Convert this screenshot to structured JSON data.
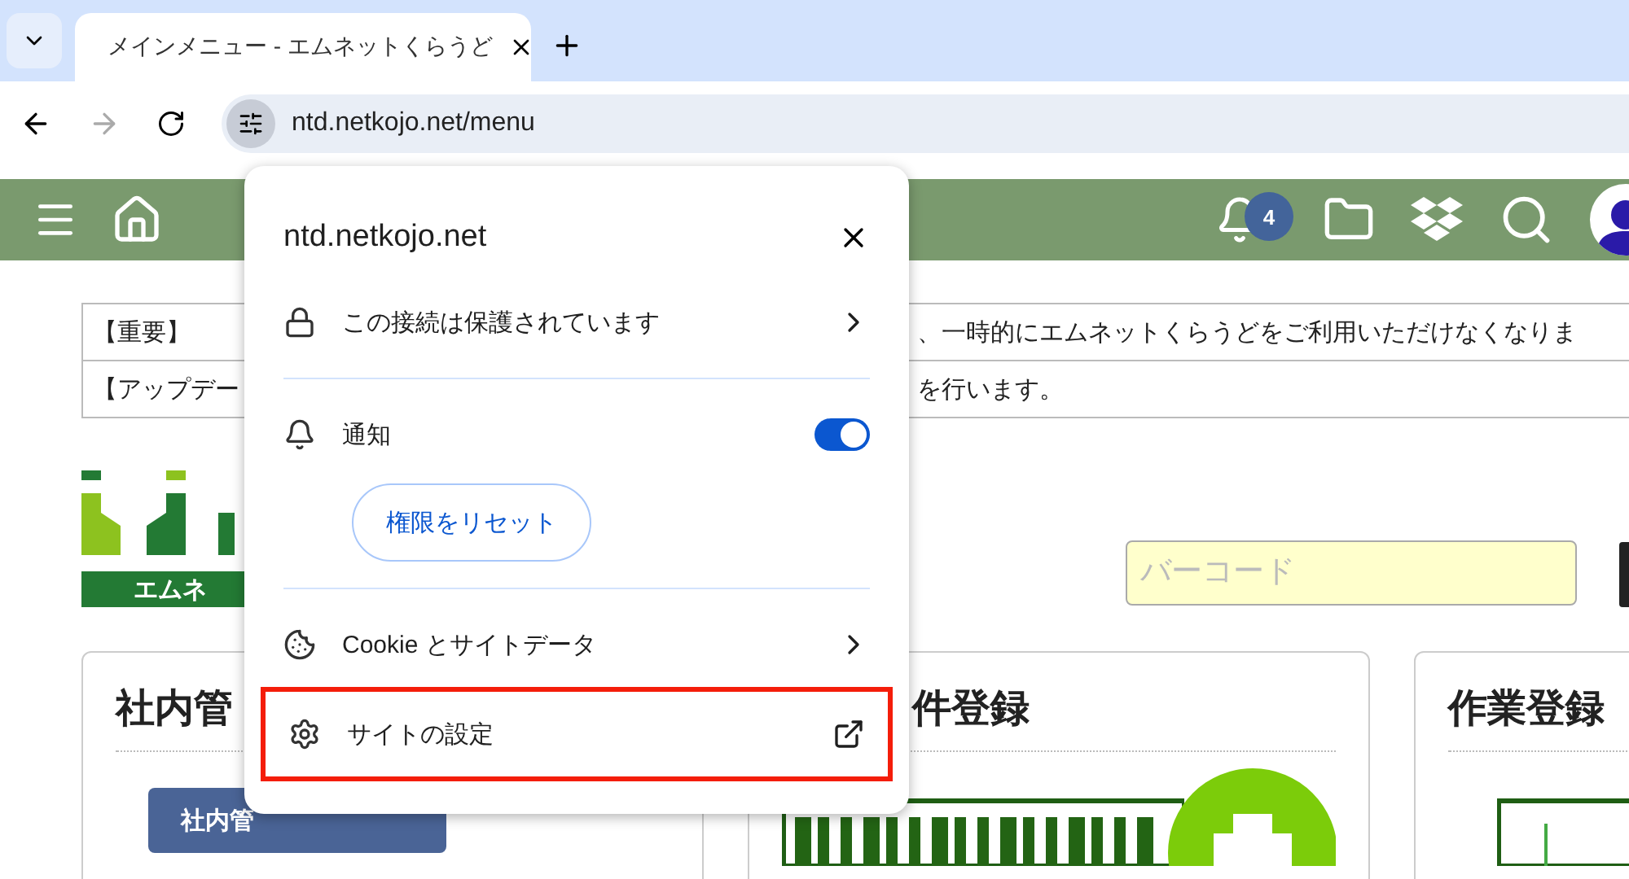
{
  "browser": {
    "tabs": [
      {
        "title": "メインメニュー - エムネットくらうど",
        "selected": true
      }
    ],
    "url": "ntd.netkojo.net/menu"
  },
  "header": {
    "notification_count": "4"
  },
  "notices": [
    {
      "label": "【重要】",
      "text": "、一時的にエムネットくらうどをご利用いただけなくなりま"
    },
    {
      "label": "【アップデー",
      "text": "を行います。"
    }
  ],
  "logo": {
    "caption": "エムネ"
  },
  "barcode": {
    "placeholder": "バーコード"
  },
  "cards": [
    {
      "kind": "button",
      "title": "社内管",
      "button": "社内管"
    },
    {
      "kind": "barcode",
      "title": "件登録"
    },
    {
      "kind": "diagram",
      "title": "作業登録"
    }
  ],
  "site_popup": {
    "site": "ntd.netkojo.net",
    "sections": [
      [
        {
          "kind": "security",
          "label": "この接続は保護されています",
          "highlighted": false
        }
      ],
      [
        {
          "kind": "notification",
          "label": "通知",
          "on": true
        },
        {
          "kind": "reset",
          "label": "権限をリセット"
        }
      ],
      [
        {
          "kind": "cookies",
          "label": "Cookie とサイトデータ",
          "highlighted": false
        },
        {
          "kind": "settings",
          "label": "サイトの設定",
          "highlighted": true
        }
      ]
    ]
  }
}
